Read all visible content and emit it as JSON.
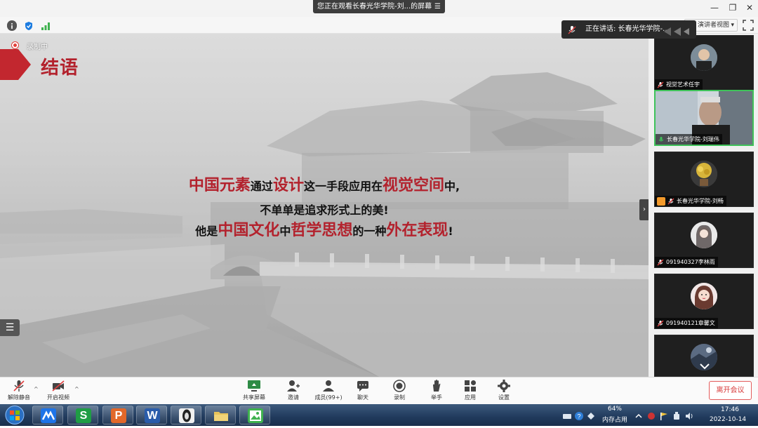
{
  "window": {
    "share_banner": "您正在观看长春光华学院-刘...的屏幕",
    "share_banner_menu": "☰",
    "minimize": "—",
    "restore": "❐",
    "close": "✕"
  },
  "meeting": {
    "speaking_label": "正在讲话: 长春光华学院-...",
    "view_label": "演讲者视图",
    "view_caret": "▾"
  },
  "slide": {
    "recording_label": "录制中",
    "heading": "结语",
    "line1": {
      "p1": "中国元素",
      "p2": "通过",
      "p3": "设计",
      "p4": "这一手段应用在",
      "p5": "视觉空间",
      "p6": "中,"
    },
    "line2": "不单单是追求形式上的美!",
    "line3": {
      "p1": "他是",
      "p2": "中国文化",
      "p3": "中",
      "p4": "哲学思想",
      "p5": "的一种",
      "p6": "外在表现",
      "p7": "!"
    },
    "list_icon": "☰",
    "collapse_icon": "›"
  },
  "participants": [
    {
      "name": "视觉艺术任宇",
      "muted": true
    },
    {
      "name": "长春光华学院-刘瑞伟",
      "muted": false,
      "active": true
    },
    {
      "name": "长春光华学院-刘畅",
      "muted": true,
      "host": true
    },
    {
      "name": "091940327李林雨",
      "muted": true
    },
    {
      "name": "091940121章馨文",
      "muted": true
    }
  ],
  "toolbar": {
    "unmute": "解除静音",
    "start_video": "开启视频",
    "share_screen": "共享屏幕",
    "invite": "邀请",
    "members": "成员(99+)",
    "chat": "聊天",
    "record": "录制",
    "raise_hand": "举手",
    "apps": "应用",
    "settings": "设置",
    "leave": "离开会议",
    "caret": "^"
  },
  "taskbar": {
    "apps": [
      "lanxin",
      "excel-s",
      "ppt-p",
      "word-w",
      "media",
      "folder",
      "image-viewer"
    ],
    "memory_percent": "64%",
    "memory_label": "内存占用",
    "time": "17:46",
    "date": "2022-10-14"
  },
  "colors": {
    "accent_red": "#b3222d",
    "active_green": "#3fc25a",
    "leave_red": "#d83b3b"
  }
}
